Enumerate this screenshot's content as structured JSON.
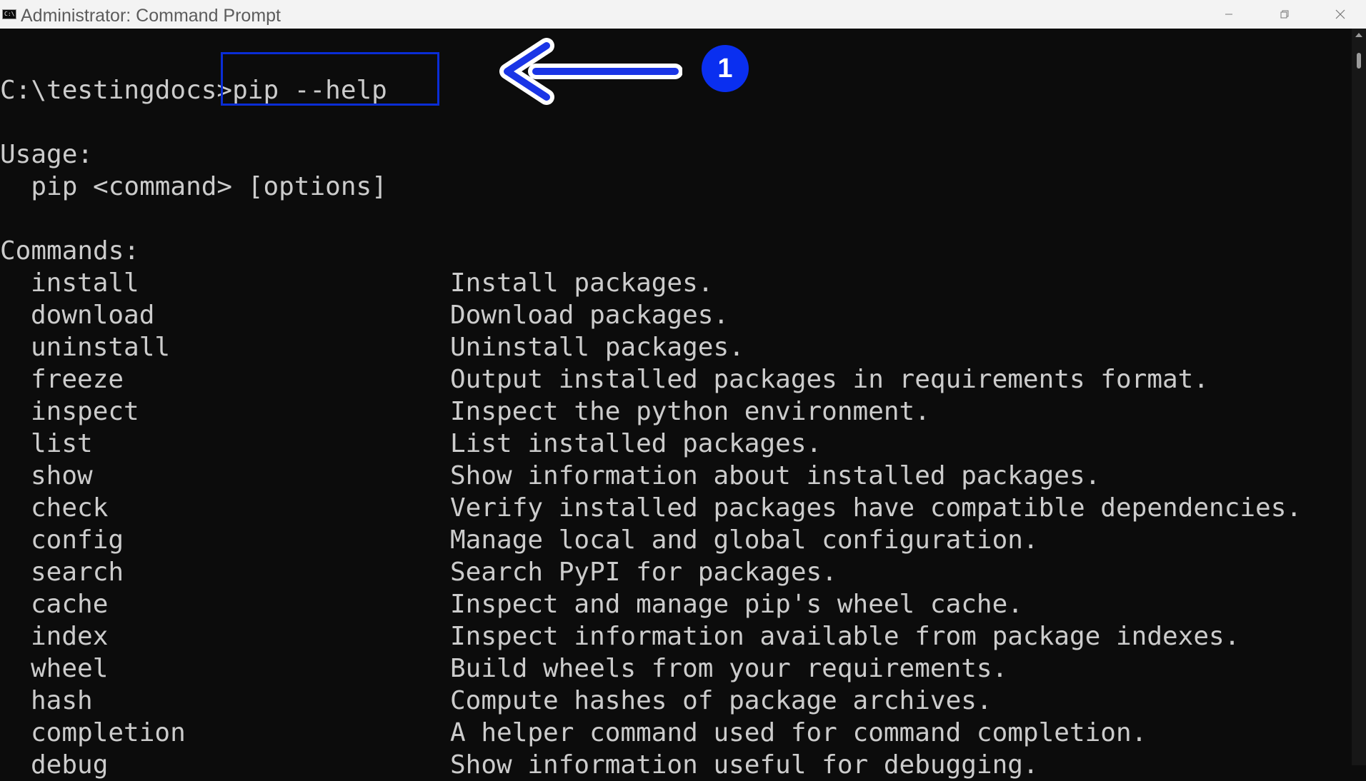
{
  "window": {
    "title": "Administrator: Command Prompt",
    "icon": "cmd-icon",
    "icon_text": "C:\\"
  },
  "controls": {
    "minimize_icon": "minimize-icon",
    "maximize_icon": "restore-icon",
    "close_icon": "close-icon"
  },
  "console": {
    "prompt": "C:\\testingdocs>",
    "command": "pip --help",
    "usage_header": "Usage:",
    "usage_line": "  pip <command> [options]",
    "commands_header": "Commands:",
    "commands": [
      {
        "name": "install",
        "desc": "Install packages."
      },
      {
        "name": "download",
        "desc": "Download packages."
      },
      {
        "name": "uninstall",
        "desc": "Uninstall packages."
      },
      {
        "name": "freeze",
        "desc": "Output installed packages in requirements format."
      },
      {
        "name": "inspect",
        "desc": "Inspect the python environment."
      },
      {
        "name": "list",
        "desc": "List installed packages."
      },
      {
        "name": "show",
        "desc": "Show information about installed packages."
      },
      {
        "name": "check",
        "desc": "Verify installed packages have compatible dependencies."
      },
      {
        "name": "config",
        "desc": "Manage local and global configuration."
      },
      {
        "name": "search",
        "desc": "Search PyPI for packages."
      },
      {
        "name": "cache",
        "desc": "Inspect and manage pip's wheel cache."
      },
      {
        "name": "index",
        "desc": "Inspect information available from package indexes."
      },
      {
        "name": "wheel",
        "desc": "Build wheels from your requirements."
      },
      {
        "name": "hash",
        "desc": "Compute hashes of package archives."
      },
      {
        "name": "completion",
        "desc": "A helper command used for command completion."
      },
      {
        "name": "debug",
        "desc": "Show information useful for debugging."
      }
    ]
  },
  "annotation": {
    "badge_number": "1",
    "box_color": "#0a2dd6",
    "badge_color": "#0a2ff0",
    "arrow_icon": "left-arrow-icon"
  },
  "colors": {
    "console_background": "#0c0c0c",
    "console_text": "#cccccc",
    "titlebar_background": "#f3f3f3"
  }
}
